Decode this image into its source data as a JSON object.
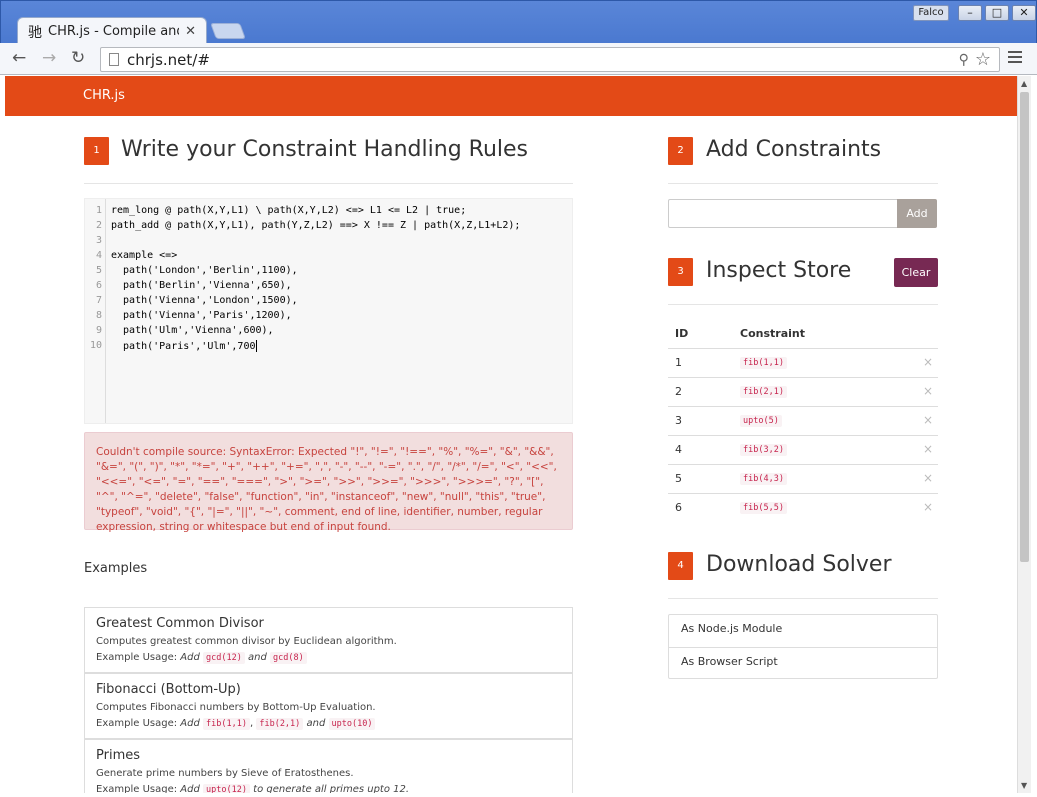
{
  "browser": {
    "tab_icon": "驰",
    "tab_title": "CHR.js - Compile and",
    "user": "Falco",
    "url": "chrjs.net/#",
    "back": "←",
    "forward": "→",
    "reload": "↻"
  },
  "navbar": {
    "brand": "CHR.js"
  },
  "section1": {
    "number": "1",
    "title": "Write your Constraint Handling Rules",
    "line_numbers": [
      "1",
      "2",
      "3",
      "4",
      "5",
      "6",
      "7",
      "8",
      "9",
      "10"
    ],
    "code_lines": [
      "rem_long @ path(X,Y,L1) \\ path(X,Y,L2) <=> L1 <= L2 | true;",
      "path_add @ path(X,Y,L1), path(Y,Z,L2) ==> X !== Z | path(X,Z,L1+L2);",
      "",
      "example <=>",
      "  path('London','Berlin',1100),",
      "  path('Berlin','Vienna',650),",
      "  path('Vienna','London',1500),",
      "  path('Vienna','Paris',1200),",
      "  path('Ulm','Vienna',600),",
      "  path('Paris','Ulm',700"
    ],
    "error": "Couldn't compile source: SyntaxError: Expected \"!\", \"!=\", \"!==\", \"%\", \"%=\", \"&\", \"&&\", \"&=\", \"(\", \")\", \"*\", \"*=\", \"+\", \"++\", \"+=\", \",\", \"-\", \"--\", \"-=\", \".\", \"/\", \"/*\", \"/=\", \"<\", \"<<\", \"<<=\", \"<=\", \"=\", \"==\", \"===\", \">\", \">=\", \">>\", \">>=\", \">>>\", \">>>=\", \"?\", \"[\", \"^\", \"^=\", \"delete\", \"false\", \"function\", \"in\", \"instanceof\", \"new\", \"null\", \"this\", \"true\", \"typeof\", \"void\", \"{\", \"|=\", \"||\", \"~\", comment, end of line, identifier, number, regular expression, string or whitespace but end of input found."
  },
  "examples": {
    "heading": "Examples",
    "items": [
      {
        "title": "Greatest Common Divisor",
        "desc": "Computes greatest common divisor by Euclidean algorithm.",
        "usage_label": "Example Usage:",
        "add": "Add",
        "c1": "gcd(12)",
        "and": "and",
        "c2": "gcd(8)"
      },
      {
        "title": "Fibonacci (Bottom-Up)",
        "desc": "Computes Fibonacci numbers by Bottom-Up Evaluation.",
        "usage_label": "Example Usage:",
        "add": "Add",
        "c1": "fib(1,1)",
        "comma": ",",
        "c2": "fib(2,1)",
        "and": "and",
        "c3": "upto(10)"
      },
      {
        "title": "Primes",
        "desc": "Generate prime numbers by Sieve of Eratosthenes.",
        "usage_label": "Example Usage:",
        "add": "Add",
        "c1": "upto(12)",
        "tail": "to generate all primes upto 12."
      }
    ]
  },
  "section2": {
    "number": "2",
    "title": "Add Constraints",
    "input_value": "",
    "add_label": "Add"
  },
  "section3": {
    "number": "3",
    "title": "Inspect Store",
    "clear_label": "Clear",
    "col_id": "ID",
    "col_constraint": "Constraint",
    "delete_glyph": "×",
    "rows": [
      {
        "id": "1",
        "constraint": "fib(1,1)"
      },
      {
        "id": "2",
        "constraint": "fib(2,1)"
      },
      {
        "id": "3",
        "constraint": "upto(5)"
      },
      {
        "id": "4",
        "constraint": "fib(3,2)"
      },
      {
        "id": "5",
        "constraint": "fib(4,3)"
      },
      {
        "id": "6",
        "constraint": "fib(5,5)"
      }
    ]
  },
  "section4": {
    "number": "4",
    "title": "Download Solver",
    "items": [
      "As Node.js Module",
      "As Browser Script"
    ]
  }
}
